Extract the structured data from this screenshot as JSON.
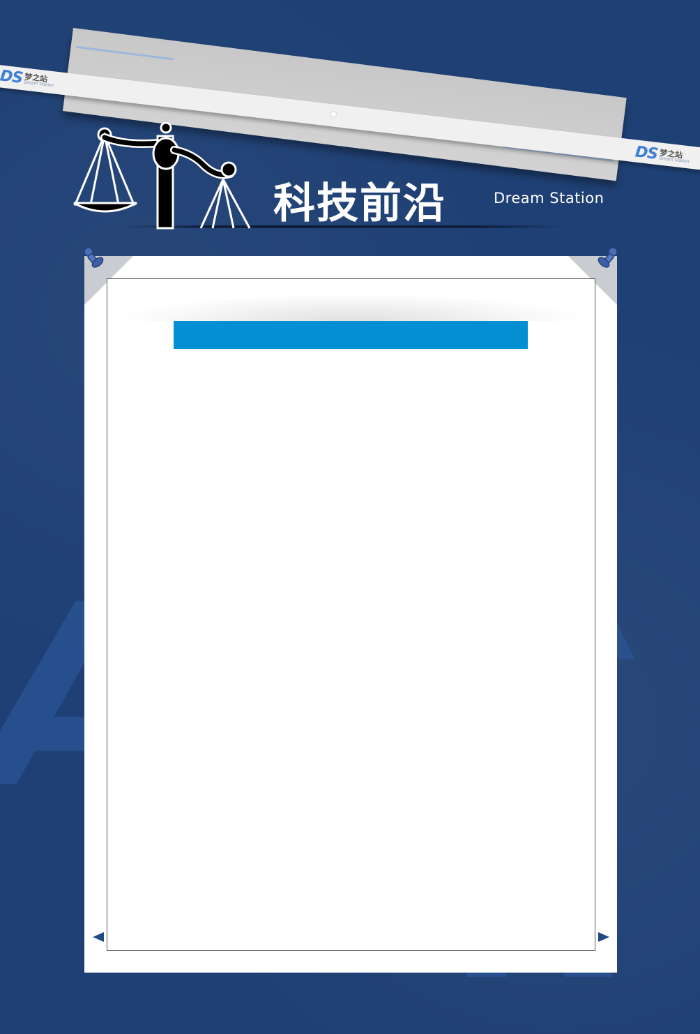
{
  "header": {
    "title_cn": "科技前沿",
    "title_en": "Dream Station",
    "emblem_icon": "scales-of-justice-icon"
  },
  "brand": {
    "logo_text": "DS",
    "logo_cn": "梦之站",
    "logo_sub": "Dream Station"
  },
  "watermark": {
    "letters": [
      "A",
      "R",
      "N"
    ]
  },
  "board": {
    "banner_color": "#058fd3",
    "prev_icon": "arrow-left-icon",
    "next_icon": "arrow-right-icon",
    "pin_icon": "pushpin-icon"
  },
  "colors": {
    "background": "#1f4074",
    "accent": "#058fd3",
    "logo_blue": "#3f7ed8"
  }
}
